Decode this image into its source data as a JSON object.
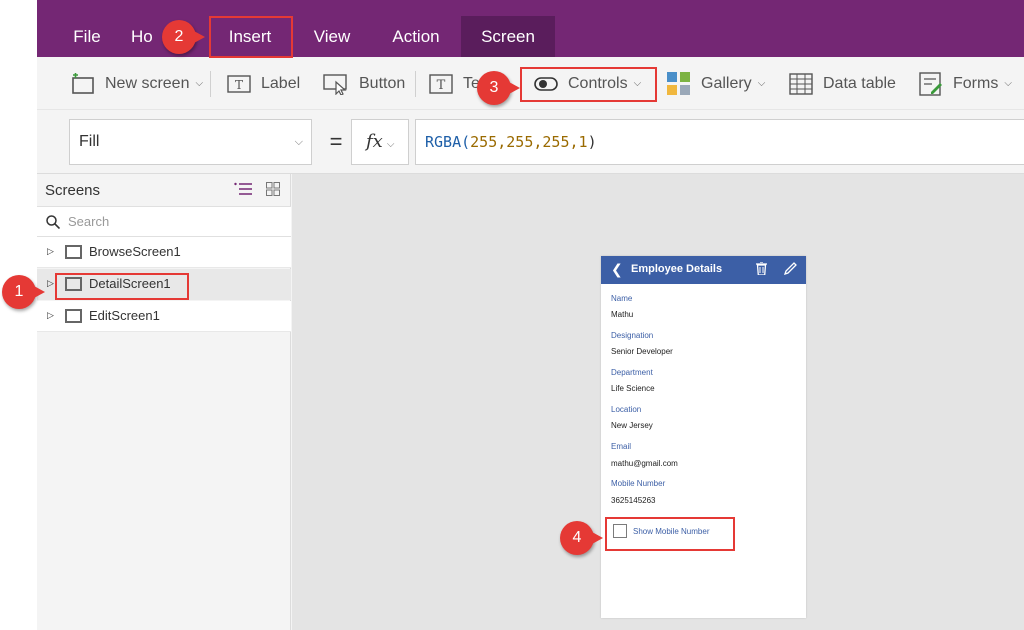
{
  "menu": {
    "file": "File",
    "home": "Ho",
    "insert": "Insert",
    "view": "View",
    "action": "Action",
    "screen": "Screen",
    "active_tab": "Screen"
  },
  "ribbon": {
    "new_screen": "New screen",
    "label": "Label",
    "button": "Button",
    "text": "Te",
    "controls": "Controls",
    "gallery": "Gallery",
    "data_table": "Data table",
    "forms": "Forms"
  },
  "formula_bar": {
    "property": "Fill",
    "equals": "=",
    "fx": "fx",
    "formula": {
      "fn": "RGBA(",
      "args": "255,255,255,1",
      "close": ")"
    }
  },
  "screens_panel": {
    "title": "Screens",
    "search_placeholder": "Search",
    "items": [
      {
        "label": "BrowseScreen1",
        "selected": false
      },
      {
        "label": "DetailScreen1",
        "selected": true
      },
      {
        "label": "EditScreen1",
        "selected": false
      }
    ]
  },
  "device": {
    "header_title": "Employee Details",
    "fields": [
      {
        "label": "Name",
        "value": "Mathu"
      },
      {
        "label": "Designation",
        "value": "Senior Developer"
      },
      {
        "label": "Department",
        "value": "Life Science"
      },
      {
        "label": "Location",
        "value": "New Jersey"
      },
      {
        "label": "Email",
        "value": "mathu@gmail.com"
      },
      {
        "label": "Mobile Number",
        "value": "3625145263"
      }
    ],
    "checkbox_label": "Show Mobile Number"
  },
  "callouts": {
    "c1": "1",
    "c2": "2",
    "c3": "3",
    "c4": "4"
  },
  "colors": {
    "menubar": "#742774",
    "active_tab": "#5a1d5c",
    "device_header": "#3c5fa6",
    "callout": "#e53935"
  },
  "icons": [
    "new-screen-icon",
    "label-icon",
    "button-icon",
    "text-icon",
    "controls-toggle-icon",
    "gallery-icon",
    "data-table-icon",
    "forms-icon",
    "search-icon",
    "list-view-icon",
    "grid-view-icon",
    "back-arrow-icon",
    "trash-icon",
    "edit-pencil-icon"
  ]
}
